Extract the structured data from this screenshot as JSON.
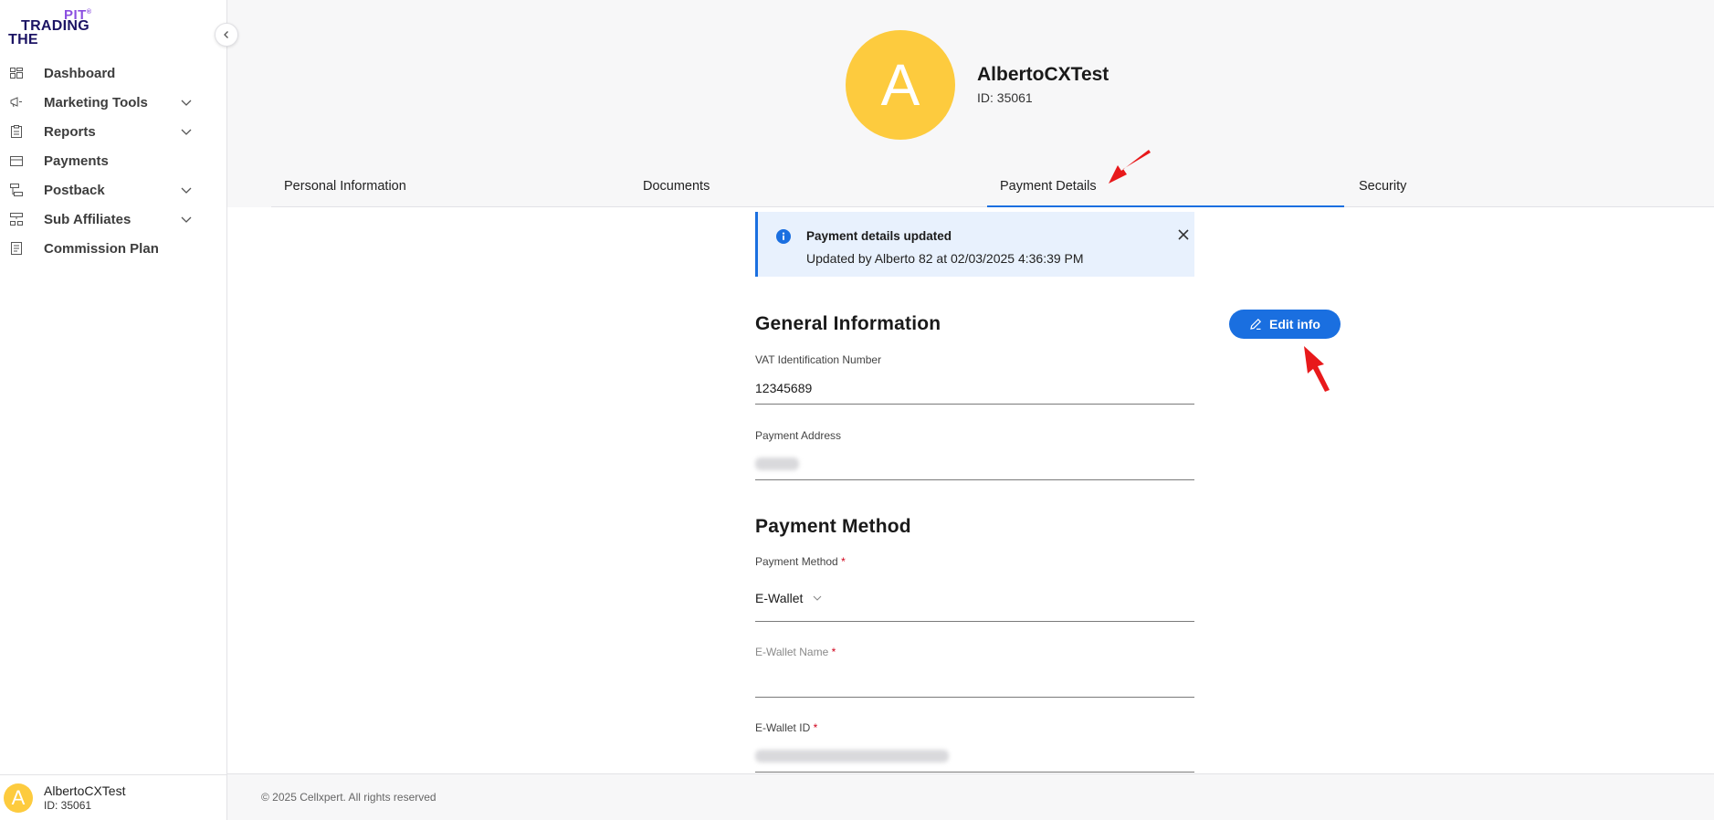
{
  "brand": {
    "logo_line1": "PIT",
    "logo_line2": "TRADING",
    "logo_line3": "THE",
    "accent": "#8b4fe0",
    "navy": "#1c1464"
  },
  "sidebar": {
    "items": [
      {
        "label": "Dashboard",
        "icon": "dashboard-icon",
        "expandable": false
      },
      {
        "label": "Marketing Tools",
        "icon": "megaphone-icon",
        "expandable": true
      },
      {
        "label": "Reports",
        "icon": "clipboard-icon",
        "expandable": true
      },
      {
        "label": "Payments",
        "icon": "credit-card-icon",
        "expandable": false
      },
      {
        "label": "Postback",
        "icon": "postback-icon",
        "expandable": true
      },
      {
        "label": "Sub Affiliates",
        "icon": "network-icon",
        "expandable": true
      },
      {
        "label": "Commission Plan",
        "icon": "document-icon",
        "expandable": false
      }
    ],
    "footer": {
      "avatar_letter": "A",
      "name": "AlbertoCXTest",
      "id": "ID: 35061"
    }
  },
  "profile": {
    "avatar_letter": "A",
    "name": "AlbertoCXTest",
    "id": "ID: 35061",
    "avatar_color": "#fdcb3e"
  },
  "tabs": [
    {
      "label": "Personal Information",
      "active": false
    },
    {
      "label": "Documents",
      "active": false
    },
    {
      "label": "Payment Details",
      "active": true
    },
    {
      "label": "Security",
      "active": false
    }
  ],
  "alert": {
    "title": "Payment details updated",
    "message": "Updated by Alberto 82 at 02/03/2025 4:36:39 PM",
    "color": "#e8f1fd"
  },
  "general": {
    "title": "General Information",
    "edit_label": "Edit info",
    "vat_label": "VAT Identification Number",
    "vat_value": "12345689",
    "address_label": "Payment Address"
  },
  "payment": {
    "title": "Payment Method",
    "method_label": "Payment Method",
    "method_value": "E-Wallet",
    "ewallet_name_label": "E-Wallet Name",
    "ewallet_id_label": "E-Wallet ID",
    "required_mark": "*"
  },
  "footer": {
    "copyright": "© 2025 Cellxpert. All rights reserved"
  },
  "colors": {
    "primary": "#1a6fe0",
    "required": "#d0021b",
    "annotation_arrow": "#e8191b"
  }
}
